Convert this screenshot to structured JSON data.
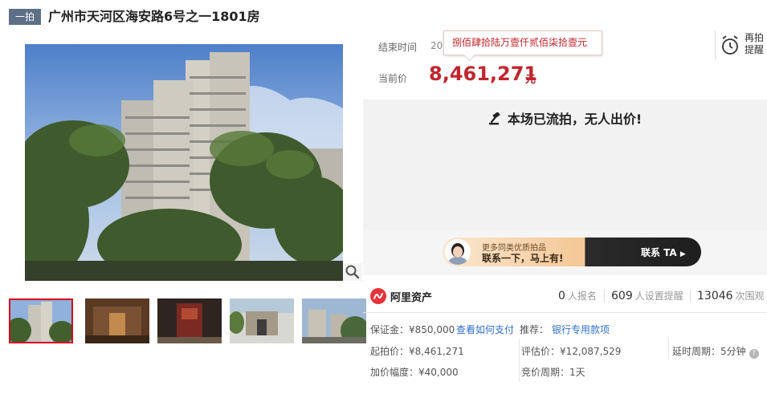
{
  "header": {
    "badge": "一拍",
    "title": "广州市天河区海安路6号之一1801房"
  },
  "auction": {
    "end_time_label": "结束时间",
    "end_time_value": "20",
    "price_tooltip": "捌佰肆拾陆万壹仟贰佰柒拾壹元",
    "current_price_label": "当前价",
    "current_price": "8,461,271",
    "price_unit": "元",
    "remind_label": "再拍提醒",
    "status": "本场已流拍，无人出价!"
  },
  "contact": {
    "subtitle": "更多同类优质拍品",
    "main": "联系一下，马上有!",
    "button": "联系 TA"
  },
  "stats": {
    "brand": "阿里资产",
    "signups": "0",
    "signups_label": "人报名",
    "reminders": "609",
    "reminders_label": "人设置提醒",
    "views": "13046",
    "views_label": "次围观"
  },
  "details": {
    "deposit": "保证金：¥850,000",
    "deposit_link": "查看如何支付",
    "recommend_label": "推荐：",
    "recommend_link": "银行专用款项",
    "start_price": "起拍价：¥8,461,271",
    "appraisal": "评估价：¥12,087,529",
    "delay": "延时周期：5分钟",
    "increment": "加价幅度：¥40,000",
    "cycle": "竞价周期：1天"
  },
  "gallery": {
    "thumbnails": [
      "building-exterior",
      "lobby-corridor",
      "entrance-door",
      "street-gate",
      "neighborhood"
    ],
    "selected_index": 0,
    "zoom_icon": "magnifier-icon"
  },
  "colors": {
    "accent_red": "#c0262d",
    "badge_bg": "#5d6f87",
    "link_blue": "#2f6fc9",
    "status_bg": "#f2f2f2"
  }
}
